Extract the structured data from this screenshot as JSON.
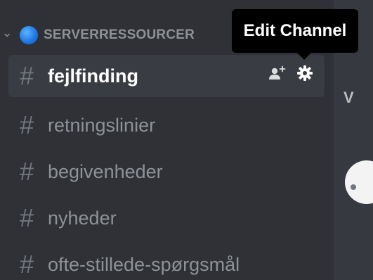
{
  "category": {
    "label": "SERVERRESSOURCER"
  },
  "channels": [
    {
      "name": "fejlfinding",
      "active": true
    },
    {
      "name": "retningslinier",
      "active": false
    },
    {
      "name": "begivenheder",
      "active": false
    },
    {
      "name": "nyheder",
      "active": false
    },
    {
      "name": "ofte-stillede-spørgsmål",
      "active": false
    }
  ],
  "channel_glyph": "#",
  "tooltip": {
    "text": "Edit Channel"
  },
  "main": {
    "partial_letter": "V"
  },
  "colors": {
    "sidebar_bg": "#2f3136",
    "main_bg": "#36393f",
    "active_channel_bg": "#393c43",
    "muted_text": "#8e9297",
    "hash": "#72767d",
    "tooltip_bg": "#000000",
    "server_dot": "#1f7ae6"
  },
  "icons": {
    "category_toggle": "chevron-down-icon",
    "create_invite": "add-user-icon",
    "settings": "gear-icon"
  }
}
